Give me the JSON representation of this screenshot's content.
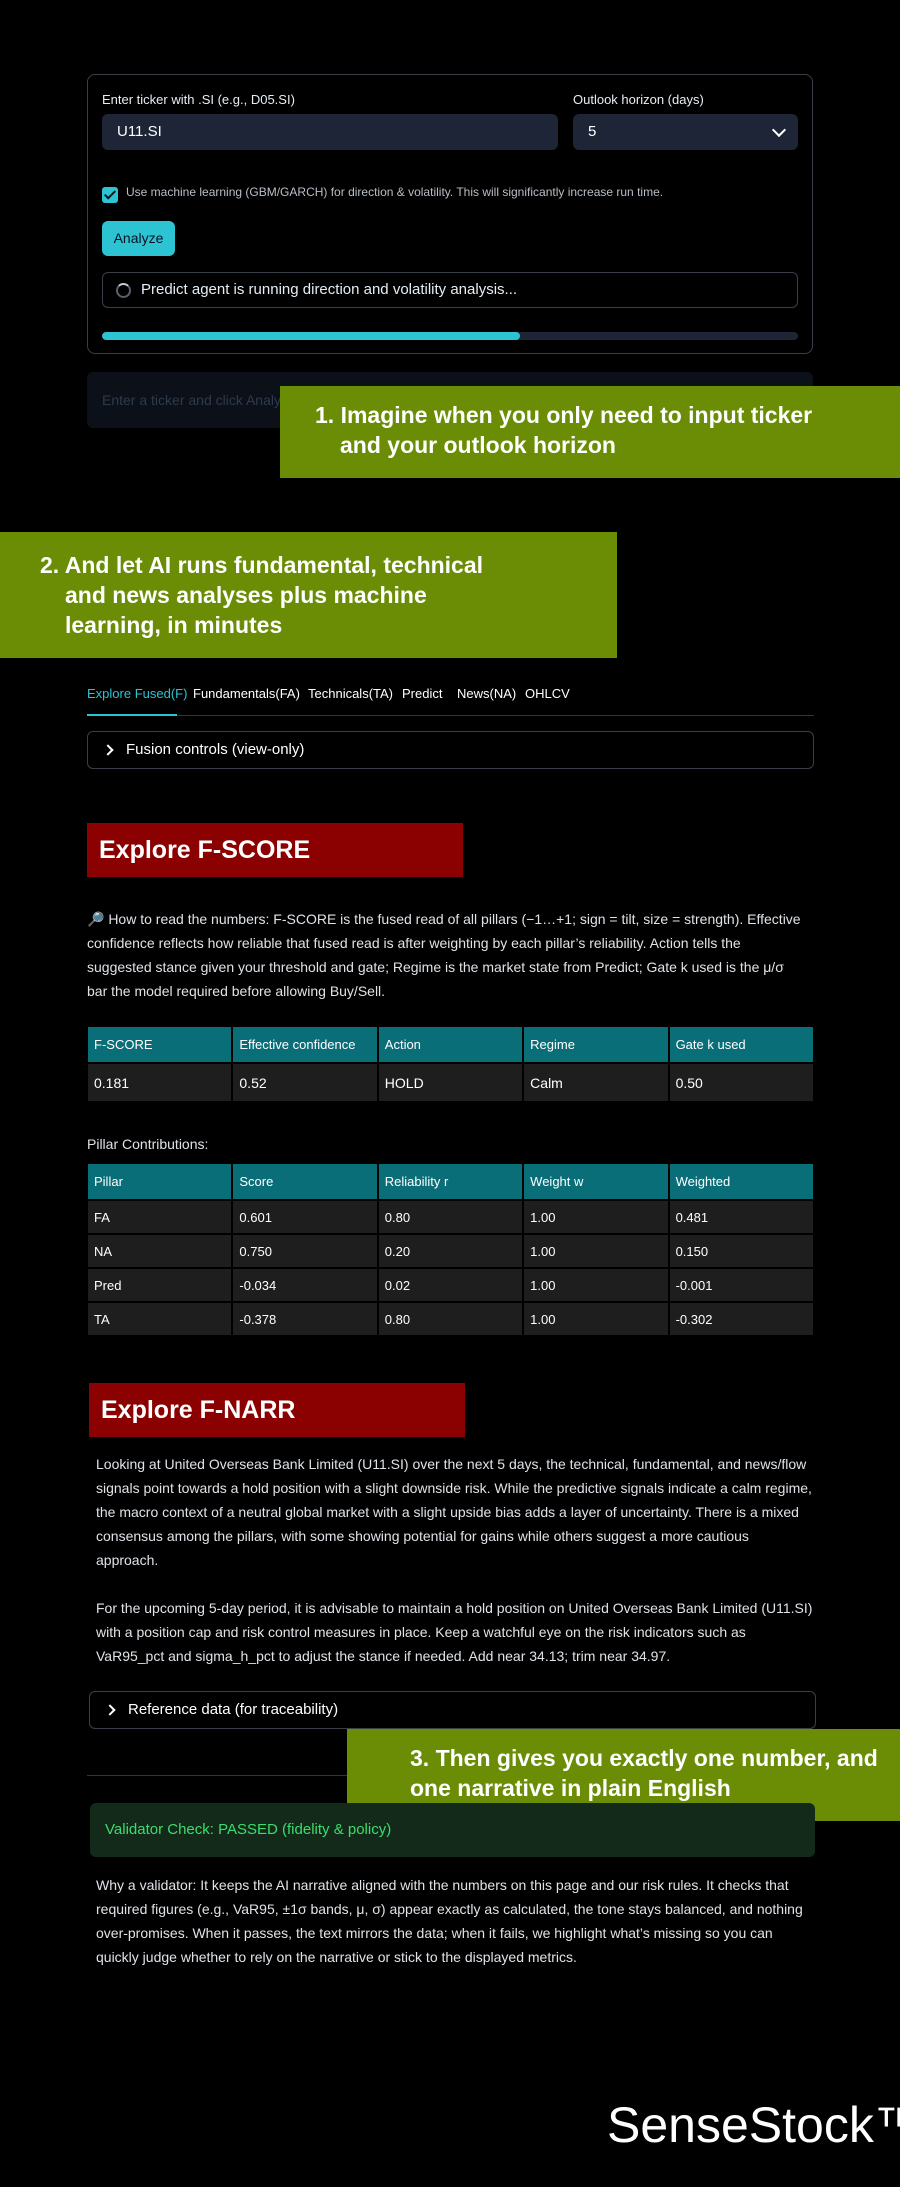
{
  "form": {
    "ticker_label": "Enter ticker with .SI (e.g., D05.SI)",
    "ticker_value": "U11.SI",
    "horizon_label": "Outlook horizon (days)",
    "horizon_value": "5",
    "ml_checkbox_checked": true,
    "ml_checkbox_label": "Use machine learning (GBM/GARCH) for direction & volatility. This will significantly increase run time.",
    "analyze_label": "Analyze",
    "status_text": "Predict agent is running direction and volatility analysis...",
    "progress_fraction": 0.6,
    "info_text": "Enter a ticker and click Analyze"
  },
  "banners": {
    "b1": [
      "1. Imagine when you only need to input ticker",
      "and your outlook horizon"
    ],
    "b2": [
      "2. And let AI runs fundamental, technical",
      "and news analyses plus machine",
      "learning, in minutes"
    ],
    "b3": [
      "3. Then gives you exactly one number, and",
      "one narrative in plain English"
    ]
  },
  "tabs": [
    "Explore Fused(F)",
    "Fundamentals(FA)",
    "Technicals(TA)",
    "Predict",
    "News(NA)",
    "OHLCV"
  ],
  "fusion_controls_label": "Fusion controls (view-only)",
  "fscore": {
    "title": "Explore F-SCORE",
    "help": "🔎 How to read the numbers: F-SCORE is the fused read of all pillars (−1…+1; sign = tilt, size = strength). Effective confidence reflects how reliable that fused read is after weighting by each pillar’s reliability. Action tells the suggested stance given your threshold and gate; Regime is the market state from Predict; Gate k used is the μ/σ bar the model required before allowing Buy/Sell.",
    "headers": [
      "F-SCORE",
      "Effective confidence",
      "Action",
      "Regime",
      "Gate k used"
    ],
    "row": [
      "0.181",
      "0.52",
      "HOLD",
      "Calm",
      "0.50"
    ]
  },
  "pillars": {
    "label": "Pillar Contributions:",
    "headers": [
      "Pillar",
      "Score",
      "Reliability r",
      "Weight w",
      "Weighted"
    ],
    "rows": [
      [
        "FA",
        "0.601",
        "0.80",
        "1.00",
        "0.481"
      ],
      [
        "NA",
        "0.750",
        "0.20",
        "1.00",
        "0.150"
      ],
      [
        "Pred",
        "-0.034",
        "0.02",
        "1.00",
        "-0.001"
      ],
      [
        "TA",
        "-0.378",
        "0.80",
        "1.00",
        "-0.302"
      ]
    ]
  },
  "fnarr": {
    "title": "Explore F-NARR",
    "p1": "Looking at United Overseas Bank Limited (U11.SI) over the next 5 days, the technical, fundamental, and news/flow signals point towards a hold position with a slight downside risk. While the predictive signals indicate a calm regime, the macro context of a neutral global market with a slight upside bias adds a layer of uncertainty. There is a mixed consensus among the pillars, with some showing potential for gains while others suggest a more cautious approach.",
    "p2": "For the upcoming 5-day period, it is advisable to maintain a hold position on United Overseas Bank Limited (U11.SI) with a position cap and risk control measures in place. Keep a watchful eye on the risk indicators such as VaR95_pct and sigma_h_pct to adjust the stance if needed. Add near 34.13; trim near 34.97.",
    "reference_label": "Reference data (for traceability)"
  },
  "validator": {
    "status": "Validator Check: PASSED (fidelity & policy)",
    "explain": "Why a validator: It keeps the AI narrative aligned with the numbers on this page and our risk rules. It checks that required figures (e.g., VaR95, ±1σ bands, μ, σ) appear exactly as calculated, the tone stays balanced, and nothing over-promises. When it passes, the text mirrors the data; when it fails, we highlight what’s missing so you can quickly judge whether to rely on the narrative or stick to the displayed metrics."
  },
  "brand": "SenseStock™"
}
